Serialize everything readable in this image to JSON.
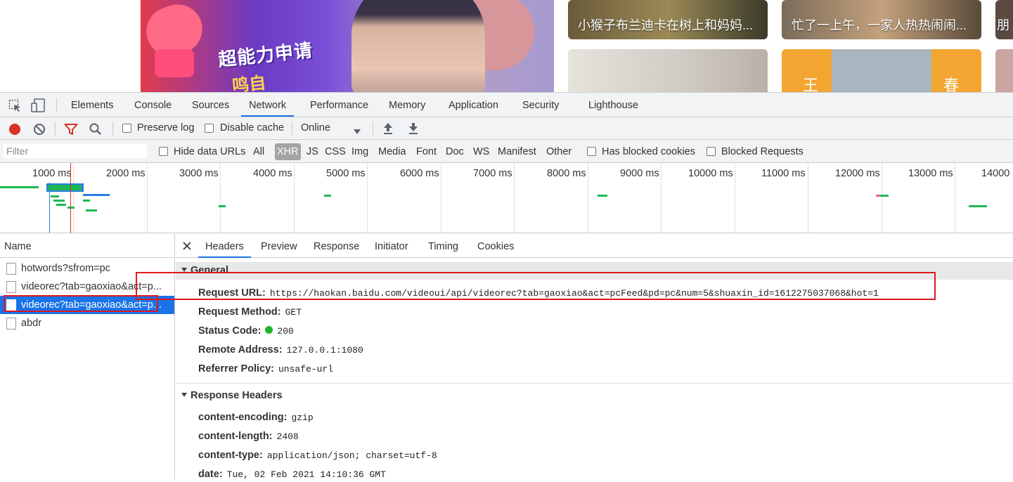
{
  "page": {
    "hero": {
      "promo_line1": "超能力申请",
      "promo_line2": "鸣自"
    },
    "cards": [
      {
        "caption": "小猴子布兰迪卡在树上和妈妈..."
      },
      {
        "caption": "忙了一上午，一家人热热闹闹..."
      },
      {
        "caption": "朋"
      },
      {
        "caption": ""
      },
      {
        "left_glyph": "王",
        "right_glyph": "春"
      },
      {
        "caption": ""
      }
    ]
  },
  "devtools": {
    "tabs": [
      "Elements",
      "Console",
      "Sources",
      "Network",
      "Performance",
      "Memory",
      "Application",
      "Security",
      "Lighthouse"
    ],
    "active_tab": "Network",
    "toolbar": {
      "preserve_log": "Preserve log",
      "disable_cache": "Disable cache",
      "throttle": "Online"
    },
    "filterbar": {
      "filter_placeholder": "Filter",
      "hide_data_urls": "Hide data URLs",
      "types": [
        "All",
        "XHR",
        "JS",
        "CSS",
        "Img",
        "Media",
        "Font",
        "Doc",
        "WS",
        "Manifest",
        "Other"
      ],
      "selected_type": "XHR",
      "has_blocked_cookies": "Has blocked cookies",
      "blocked_requests": "Blocked Requests"
    },
    "overview_ticks": [
      "1000 ms",
      "2000 ms",
      "3000 ms",
      "4000 ms",
      "5000 ms",
      "6000 ms",
      "7000 ms",
      "8000 ms",
      "9000 ms",
      "10000 ms",
      "11000 ms",
      "12000 ms",
      "13000 ms",
      "14000"
    ],
    "request_list": {
      "header": "Name",
      "items": [
        "hotwords?sfrom=pc",
        "videorec?tab=gaoxiao&act=p...",
        "videorec?tab=gaoxiao&act=p...",
        "abdr"
      ],
      "selected_index": 2
    },
    "detail": {
      "tabs": [
        "Headers",
        "Preview",
        "Response",
        "Initiator",
        "Timing",
        "Cookies"
      ],
      "active_tab": "Headers",
      "general": {
        "title": "General",
        "rows": [
          {
            "key": "Request URL:",
            "value": "https://haokan.baidu.com/videoui/api/videorec?tab=gaoxiao&act=pcFeed&pd=pc&num=5&shuaxin_id=1612275037068&hot=1"
          },
          {
            "key": "Request Method:",
            "value": "GET"
          },
          {
            "key": "Status Code:",
            "value": "200"
          },
          {
            "key": "Remote Address:",
            "value": "127.0.0.1:1080"
          },
          {
            "key": "Referrer Policy:",
            "value": "unsafe-url"
          }
        ]
      },
      "response_headers": {
        "title": "Response Headers",
        "rows": [
          {
            "key": "content-encoding:",
            "value": "gzip"
          },
          {
            "key": "content-length:",
            "value": "2408"
          },
          {
            "key": "content-type:",
            "value": "application/json; charset=utf-8"
          },
          {
            "key": "date:",
            "value": "Tue, 02 Feb 2021 14:10:36 GMT"
          }
        ]
      }
    }
  },
  "colors": {
    "accent": "#1a73e8",
    "record": "#d93025",
    "highlight_box": "#e0191e",
    "status_ok": "#18b52a"
  }
}
